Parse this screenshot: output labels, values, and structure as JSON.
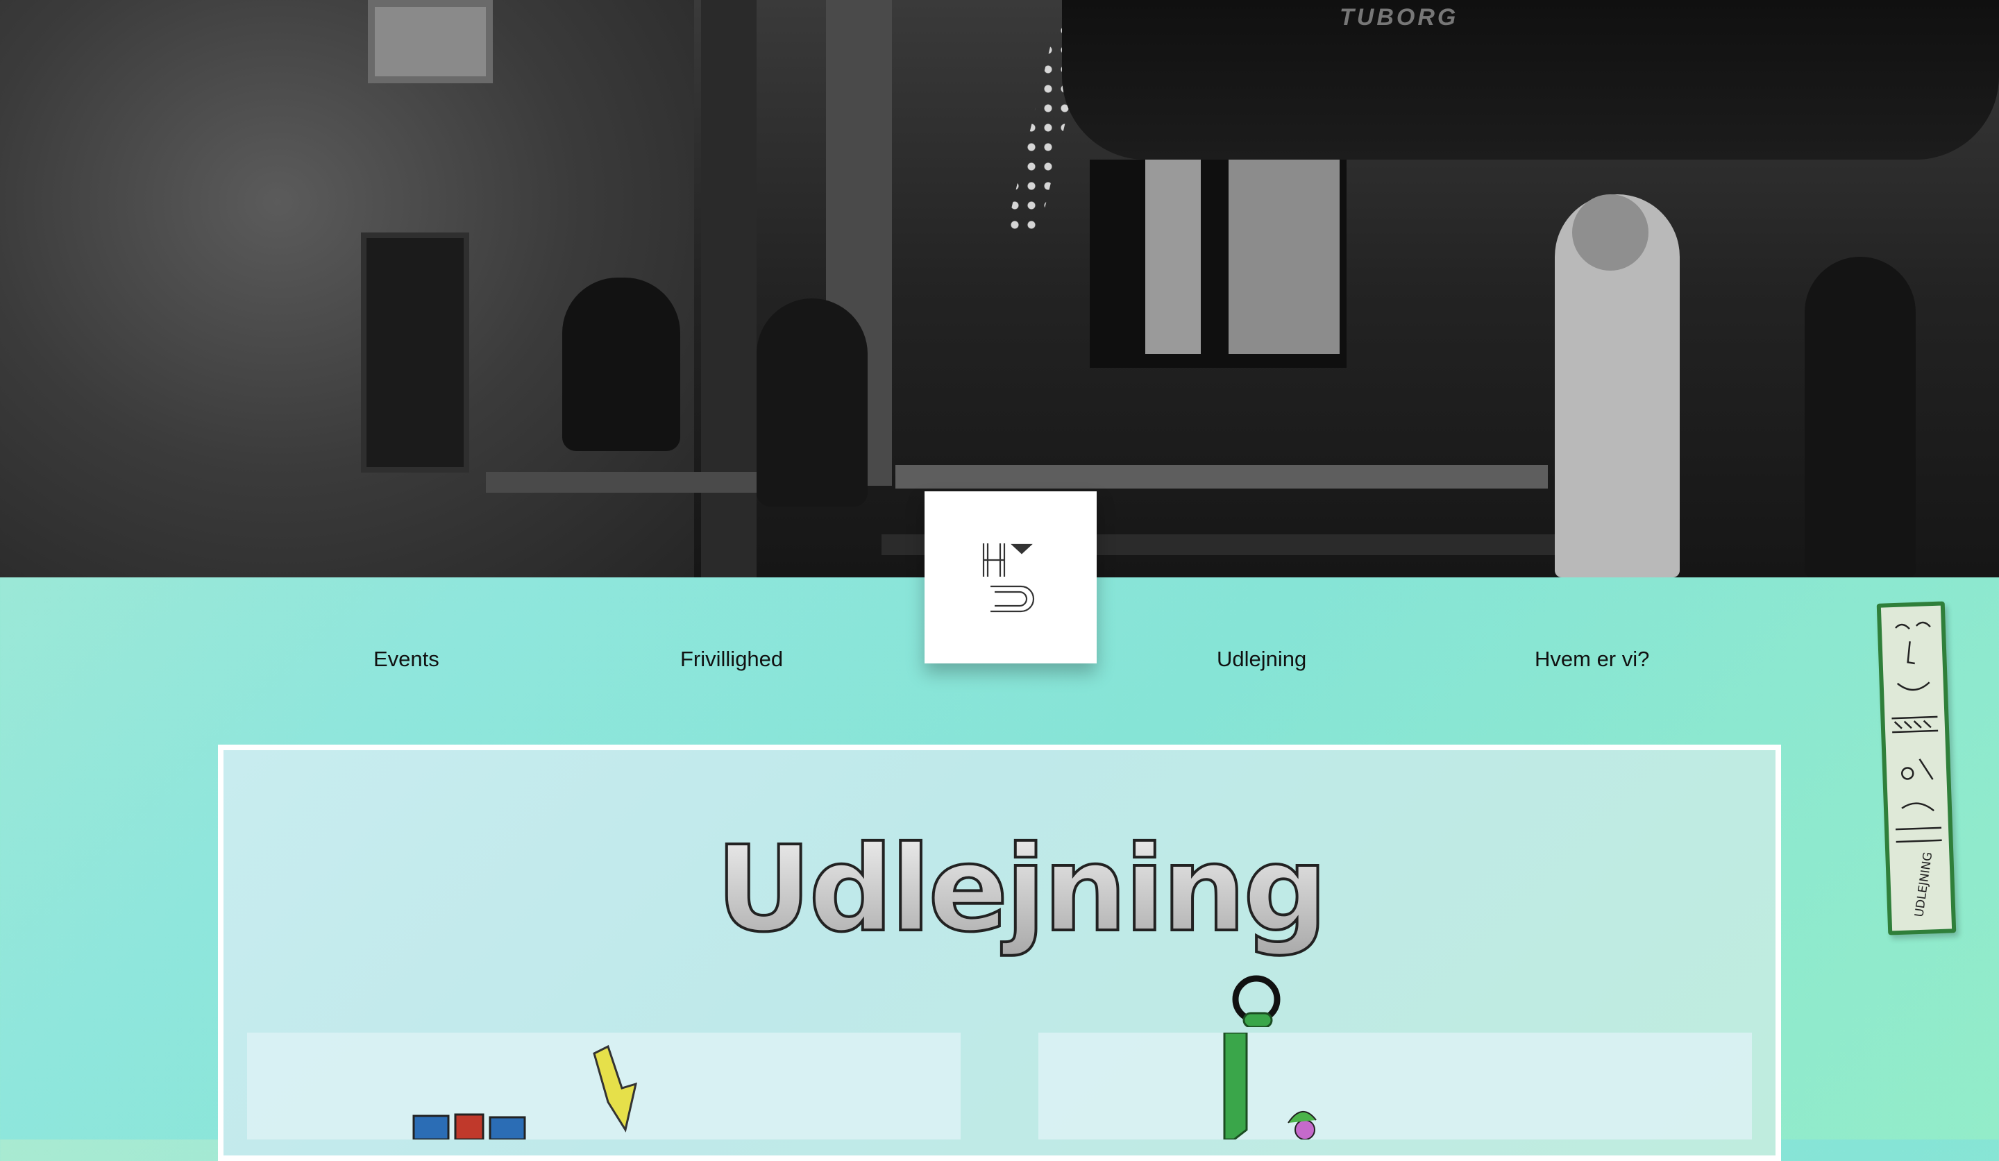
{
  "hero": {
    "umbrella_brand": "TUBORG"
  },
  "logo": {
    "alt": "HU logo"
  },
  "nav": {
    "items": [
      {
        "label": "Events"
      },
      {
        "label": "Frivillighed"
      },
      {
        "label": "Udlejning"
      },
      {
        "label": "Hvem er vi?"
      }
    ]
  },
  "side_tag": {
    "label": "UDLEJNING"
  },
  "page": {
    "title": "Udlejning"
  },
  "colors": {
    "background_mint": "#8fe6dc",
    "frame_border": "#ffffff",
    "side_tag_green": "#2f7f3a"
  }
}
